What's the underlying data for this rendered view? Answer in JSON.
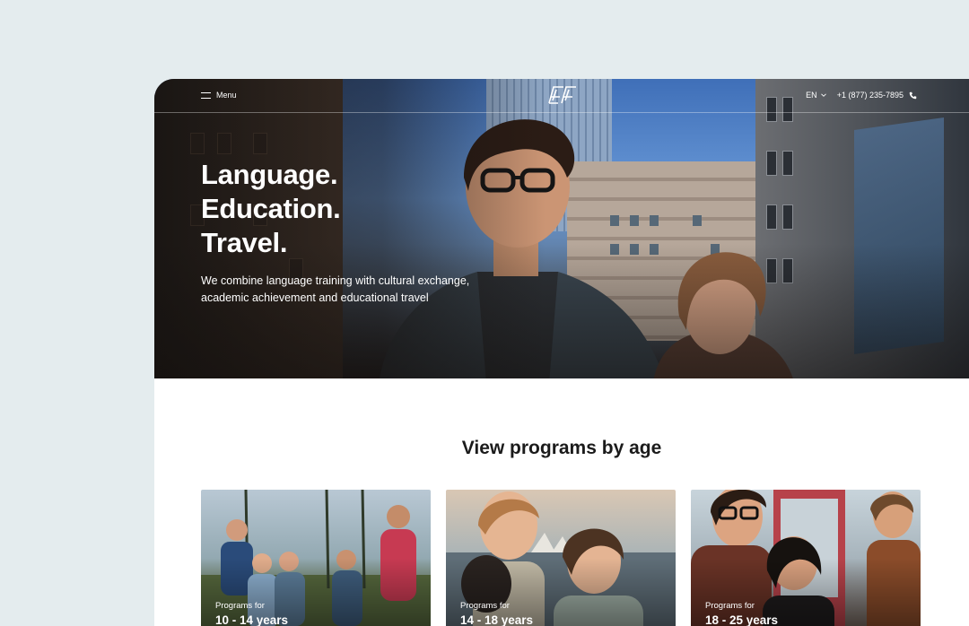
{
  "nav": {
    "menu_label": "Menu",
    "language": "EN",
    "phone": "+1 (877) 235-7895"
  },
  "hero": {
    "title_lines": [
      "Language.",
      "Education.",
      "Travel."
    ],
    "subtitle": "We combine language training with cultural exchange, academic achievement and educational travel"
  },
  "programs": {
    "heading": "View programs by age",
    "cards": [
      {
        "prefix": "Programs for",
        "age_range": "10 - 14 years"
      },
      {
        "prefix": "Programs for",
        "age_range": "14 - 18 years"
      },
      {
        "prefix": "Programs for",
        "age_range": "18 - 25 years"
      }
    ]
  },
  "colors": {
    "page_background": "#e4ecee",
    "text_dark": "#1b1b1b",
    "text_light": "#ffffff"
  },
  "icons": [
    "menu-icon",
    "ef-logo",
    "chevron-down-icon",
    "phone-icon"
  ]
}
